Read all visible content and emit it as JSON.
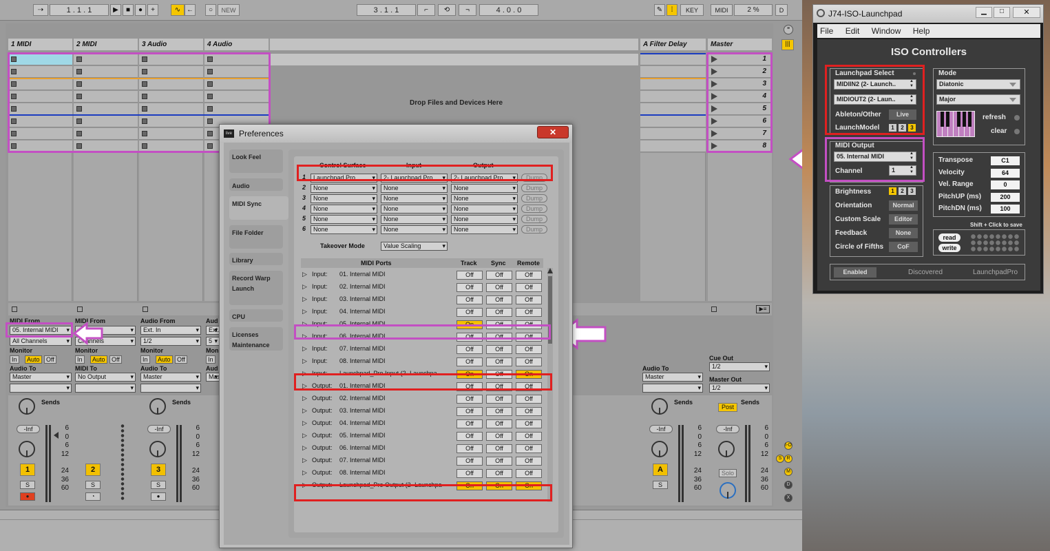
{
  "transport": {
    "arrangement_position": "1 .  1 .  1",
    "new_label": "NEW",
    "loop_start": "3 .  1 .  1",
    "loop_length": "4 .  0 .  0",
    "key_label": "KEY",
    "midi_label": "MIDI",
    "cpu": "2 %",
    "d_label": "D"
  },
  "session": {
    "tracks": [
      {
        "name": "1 MIDI"
      },
      {
        "name": "2 MIDI"
      },
      {
        "name": "3 Audio"
      },
      {
        "name": "4 Audio"
      }
    ],
    "return_track": {
      "name": "A Filter Delay"
    },
    "master": {
      "name": "Master",
      "scenes": [
        "1",
        "2",
        "3",
        "4",
        "5",
        "6",
        "7",
        "8"
      ]
    },
    "drop_text": "Drop Files and Devices Here",
    "io": {
      "t1": {
        "from_label": "MIDI From",
        "from_value": "05. Internal MIDI",
        "channel": "All Channels",
        "monitor_label": "Monitor",
        "mon_in": "In",
        "mon_auto": "Auto",
        "mon_off": "Off",
        "to_label": "Audio To",
        "to_value": "Master"
      },
      "t2": {
        "from_label": "MIDI From",
        "channel": "Channels",
        "monitor_label": "Monitor",
        "mon_in": "In",
        "mon_auto": "Auto",
        "mon_off": "Off",
        "to_label": "MIDI To",
        "to_value": "No Output"
      },
      "t3": {
        "from_label": "Audio From",
        "from_value": "Ext. In",
        "channel": "1/2",
        "monitor_label": "Monitor",
        "mon_in": "In",
        "mon_auto": "Auto",
        "mon_off": "Off",
        "to_label": "Audio To",
        "to_value": "Master"
      },
      "t4": {
        "from_label": "Aud",
        "from_value": "Ext.",
        "channel": "5",
        "monitor_label": "Mon",
        "mon_in": "In",
        "to_label": "Aud",
        "to_value": "Mas"
      },
      "ret": {
        "to_label": "Audio To",
        "to_value": "Master"
      },
      "master": {
        "cue_label": "Cue Out",
        "cue_value": "1/2",
        "out_label": "Master Out",
        "out_value": "1/2"
      }
    },
    "mixer": {
      "sends_label": "Sends",
      "post_label": "Post",
      "vol": "-Inf",
      "scale": [
        "6",
        "0",
        "6",
        "12",
        "24",
        "36",
        "60"
      ],
      "track_numbers": [
        "1",
        "2",
        "3"
      ],
      "return_letter": "A",
      "solo_label": "S",
      "master_solo": "Solo"
    }
  },
  "prefs": {
    "title": "Preferences",
    "tabs": [
      "Look Feel",
      "Audio",
      "MIDI Sync",
      "File Folder",
      "Library",
      "Record Warp Launch",
      "CPU",
      "Licenses Maintenance"
    ],
    "active_tab": "MIDI Sync",
    "headers": {
      "surface": "Control Surface",
      "input": "Input",
      "output": "Output"
    },
    "surfaces": [
      {
        "n": "1",
        "surface": "Launchpad Pro",
        "input": "2- Launchpad Pro",
        "output": "2- Launchpad Pro"
      },
      {
        "n": "2",
        "surface": "None",
        "input": "None",
        "output": "None"
      },
      {
        "n": "3",
        "surface": "None",
        "input": "None",
        "output": "None"
      },
      {
        "n": "4",
        "surface": "None",
        "input": "None",
        "output": "None"
      },
      {
        "n": "5",
        "surface": "None",
        "input": "None",
        "output": "None"
      },
      {
        "n": "6",
        "surface": "None",
        "input": "None",
        "output": "None"
      }
    ],
    "dump_label": "Dump",
    "takeover_label": "Takeover Mode",
    "takeover_value": "Value Scaling",
    "ports_header": {
      "ports": "MIDI Ports",
      "track": "Track",
      "sync": "Sync",
      "remote": "Remote"
    },
    "ports": [
      {
        "dir": "Input:",
        "name": "01. Internal MIDI",
        "track": "Off",
        "sync": "Off",
        "remote": "Off"
      },
      {
        "dir": "Input:",
        "name": "02. Internal MIDI",
        "track": "Off",
        "sync": "Off",
        "remote": "Off"
      },
      {
        "dir": "Input:",
        "name": "03. Internal MIDI",
        "track": "Off",
        "sync": "Off",
        "remote": "Off"
      },
      {
        "dir": "Input:",
        "name": "04. Internal MIDI",
        "track": "Off",
        "sync": "Off",
        "remote": "Off"
      },
      {
        "dir": "Input:",
        "name": "05. Internal MIDI",
        "track": "On",
        "sync": "Off",
        "remote": "Off"
      },
      {
        "dir": "Input:",
        "name": "06. Internal MIDI",
        "track": "Off",
        "sync": "Off",
        "remote": "Off"
      },
      {
        "dir": "Input:",
        "name": "07. Internal MIDI",
        "track": "Off",
        "sync": "Off",
        "remote": "Off"
      },
      {
        "dir": "Input:",
        "name": "08. Internal MIDI",
        "track": "Off",
        "sync": "Off",
        "remote": "Off"
      },
      {
        "dir": "Input:",
        "name": "Launchpad_Pro Input (2- Launchpa",
        "track": "On",
        "sync": "Off",
        "remote": "On"
      },
      {
        "dir": "Output:",
        "name": "01. Internal MIDI",
        "track": "Off",
        "sync": "Off",
        "remote": "Off"
      },
      {
        "dir": "Output:",
        "name": "02. Internal MIDI",
        "track": "Off",
        "sync": "Off",
        "remote": "Off"
      },
      {
        "dir": "Output:",
        "name": "03. Internal MIDI",
        "track": "Off",
        "sync": "Off",
        "remote": "Off"
      },
      {
        "dir": "Output:",
        "name": "04. Internal MIDI",
        "track": "Off",
        "sync": "Off",
        "remote": "Off"
      },
      {
        "dir": "Output:",
        "name": "05. Internal MIDI",
        "track": "Off",
        "sync": "Off",
        "remote": "Off"
      },
      {
        "dir": "Output:",
        "name": "06. Internal MIDI",
        "track": "Off",
        "sync": "Off",
        "remote": "Off"
      },
      {
        "dir": "Output:",
        "name": "07. Internal MIDI",
        "track": "Off",
        "sync": "Off",
        "remote": "Off"
      },
      {
        "dir": "Output:",
        "name": "08. Internal MIDI",
        "track": "Off",
        "sync": "Off",
        "remote": "Off"
      },
      {
        "dir": "Output:",
        "name": "Launchpad_Pro Output (2- Launchpa",
        "track": "On",
        "sync": "On",
        "remote": "On"
      }
    ]
  },
  "iso": {
    "window_title": "J74-ISO-Launchpad",
    "menu": [
      "File",
      "Edit",
      "Window",
      "Help"
    ],
    "heading": "ISO Controllers",
    "lp_select": {
      "label": "Launchpad Select",
      "midi_in": "MIDIIN2 (2- Launch..",
      "midi_out": "MIDIOUT2 (2- Laun..",
      "ableton_label": "Ableton/Other",
      "ableton_value": "Live",
      "model_label": "LaunchModel",
      "models": [
        "1",
        "2",
        "3"
      ]
    },
    "mode": {
      "label": "Mode",
      "mode_value": "Diatonic",
      "scale_value": "Major",
      "refresh": "refresh",
      "clear": "clear"
    },
    "midi_output": {
      "label": "MIDI Output",
      "port": "05. Internal MIDI",
      "channel_label": "Channel",
      "channel": "1"
    },
    "params": [
      {
        "label": "Transpose",
        "value": "C1"
      },
      {
        "label": "Velocity",
        "value": "64"
      },
      {
        "label": "Vel. Range",
        "value": "0"
      },
      {
        "label": "PitchUP (ms)",
        "value": "200"
      },
      {
        "label": "PitchDN (ms)",
        "value": "100"
      }
    ],
    "settings": [
      {
        "label": "Brightness",
        "value": ""
      },
      {
        "label": "Orientation",
        "value": "Normal"
      },
      {
        "label": "Custom Scale",
        "value": "Editor"
      },
      {
        "label": "Feedback",
        "value": "None"
      },
      {
        "label": "Circle of Fifths",
        "value": "CoF"
      }
    ],
    "brightness": [
      "1",
      "2",
      "3"
    ],
    "save_hint": "Shift + Click to save",
    "read": "read",
    "write": "write",
    "status": {
      "enabled": "Enabled",
      "discovered": "Discovered",
      "device": "LaunchpadPro"
    }
  },
  "colors": {
    "accent_yellow": "#f5c600",
    "highlight_red": "#e02020",
    "highlight_purple": "#c34fc3"
  }
}
